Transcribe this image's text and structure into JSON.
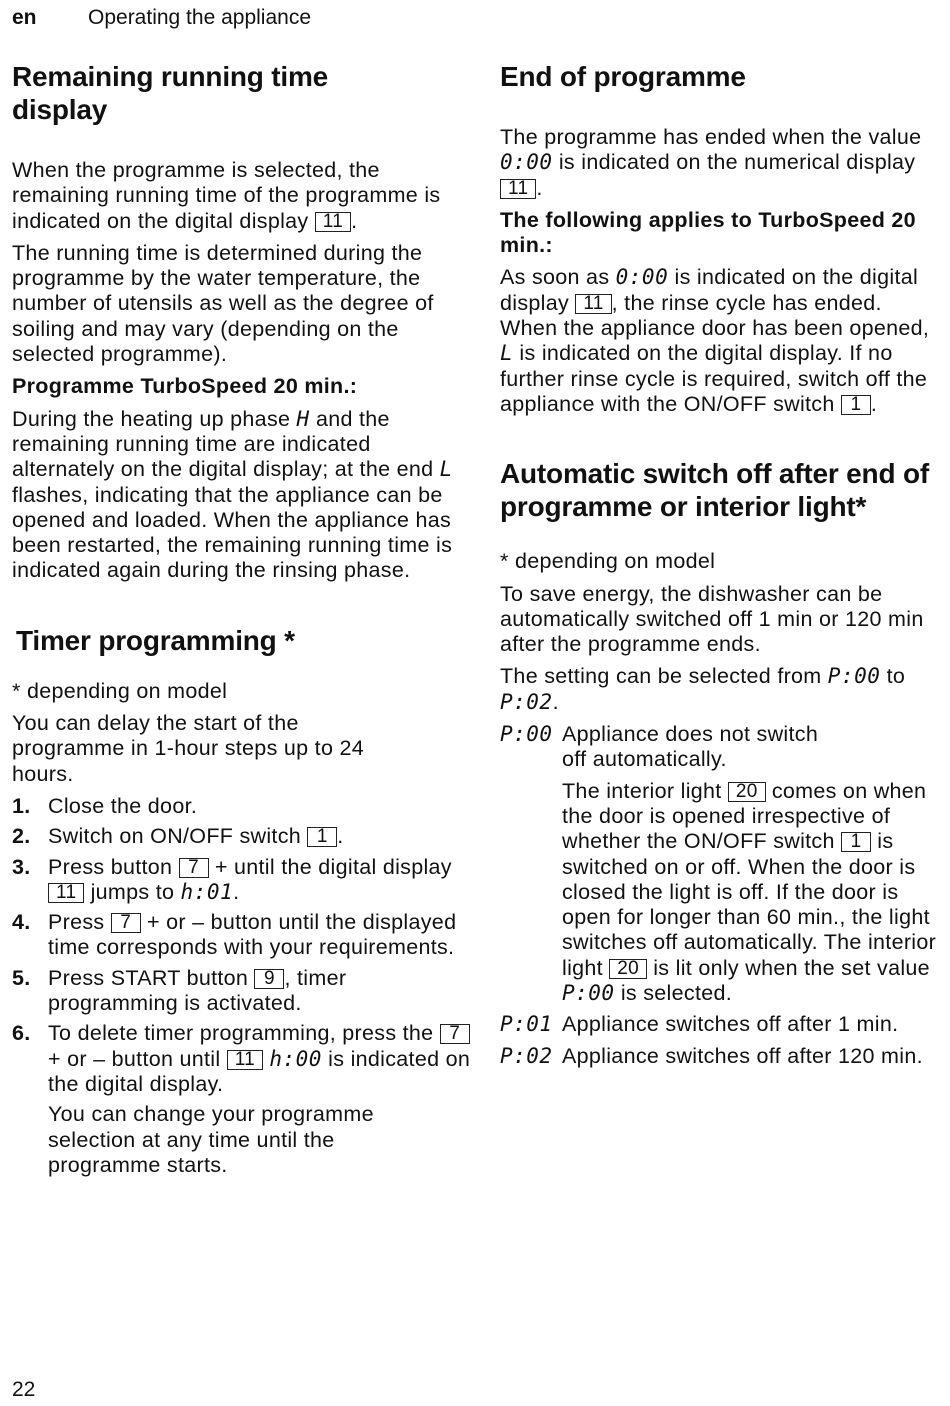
{
  "header": {
    "language": "en",
    "section": "Operating the appliance"
  },
  "left": {
    "remaining": {
      "heading": "Remaining running time display",
      "p1_a": "When the programme is selected, the remaining running time of the programme is indicated on the digital display ",
      "p1_ref": "11",
      "p1_b": ".",
      "p2": "The running time is determined during the programme by the water temperature, the number of utensils as well as the degree of soiling and may vary (depending on the selected programme).",
      "turbo_label": "Programme TurboSpeed 20 min.:",
      "p3_a": "During the heating up phase ",
      "p3_seg1": "H",
      "p3_b": " and the remaining running time are indicated alternately on the digital display; at the end ",
      "p3_seg2": "L",
      "p3_c": " flashes, indicating that the appliance can be opened and loaded. When the appliance has been restarted, the remaining running time is indicated again during the rinsing phase."
    },
    "timer": {
      "heading": "Timer programming *",
      "footnote": "* depending on model",
      "intro": "You can delay the start of the programme in 1-hour steps up to 24 hours.",
      "steps": [
        {
          "num": "1.",
          "a": "Close the door."
        },
        {
          "num": "2.",
          "a": "Switch on ON/OFF switch ",
          "ref": "1",
          "b": "."
        },
        {
          "num": "3.",
          "a": "Press button ",
          "ref": "7",
          "b": " + until the digital display ",
          "ref2": "11",
          "c": " jumps to ",
          "seg": "h:01",
          "d": "."
        },
        {
          "num": "4.",
          "a": "Press ",
          "ref": "7",
          "b": " + or – button until the displayed time corresponds with your requirements."
        },
        {
          "num": "5.",
          "a": "Press START button ",
          "ref": "9",
          "b": ", timer programming is activated."
        },
        {
          "num": "6.",
          "a": "To delete timer programming, press the ",
          "ref": "7",
          "b": " + or – button until ",
          "ref2": "11",
          "seg": "h:00",
          "c": " is indicated on the digital display."
        }
      ],
      "note": "You can change your programme selection at any time until the programme starts."
    }
  },
  "right": {
    "end": {
      "heading": "End of programme",
      "p1_a": "The programme has ended when the value ",
      "p1_seg": "0:00",
      "p1_b": " is indicated on the numerical display ",
      "p1_ref": "11",
      "p1_c": ".",
      "turbo_label": "The following applies to TurboSpeed 20 min.:",
      "p2_a": "As soon as ",
      "p2_seg": "0:00",
      "p2_b": " is indicated on the digital display ",
      "p2_ref": "11",
      "p2_c": ", the rinse cycle has ended. When the appliance door has been opened, ",
      "p2_seg2": "L",
      "p2_d": " is indicated on the digital display. If no further rinse cycle is required, switch off the appliance with the ON/OFF switch ",
      "p2_ref2": "1",
      "p2_e": "."
    },
    "auto": {
      "heading": "Automatic switch off after end of programme or interior light*",
      "footnote": "* depending on model",
      "p1": "To save energy, the dishwasher can be automatically switched off 1 min or 120 min after the programme ends.",
      "p2_a": "The setting can be selected from ",
      "p2_seg1": "P:00",
      "p2_b": " to ",
      "p2_seg2": "P:02",
      "p2_c": ".",
      "settings": [
        {
          "key": "P:00",
          "text": "Appliance does not switch off automatically.",
          "extra_a": "The interior light ",
          "extra_ref": "20",
          "extra_b": " comes on when the door is opened irrespective of whether the ON/OFF switch ",
          "extra_ref2": "1",
          "extra_c": " is switched on or off. When the door is closed the light is off. If the door is open for longer than 60 min., the light switches off automatically. The interior light ",
          "extra_ref3": "20",
          "extra_d": " is lit only when the set value ",
          "extra_seg": "P:00",
          "extra_e": " is selected."
        },
        {
          "key": "P:01",
          "text": "Appliance switches off after 1 min."
        },
        {
          "key": "P:02",
          "text": "Appliance switches off after 120 min."
        }
      ]
    }
  },
  "footer": {
    "page_number": "22"
  }
}
